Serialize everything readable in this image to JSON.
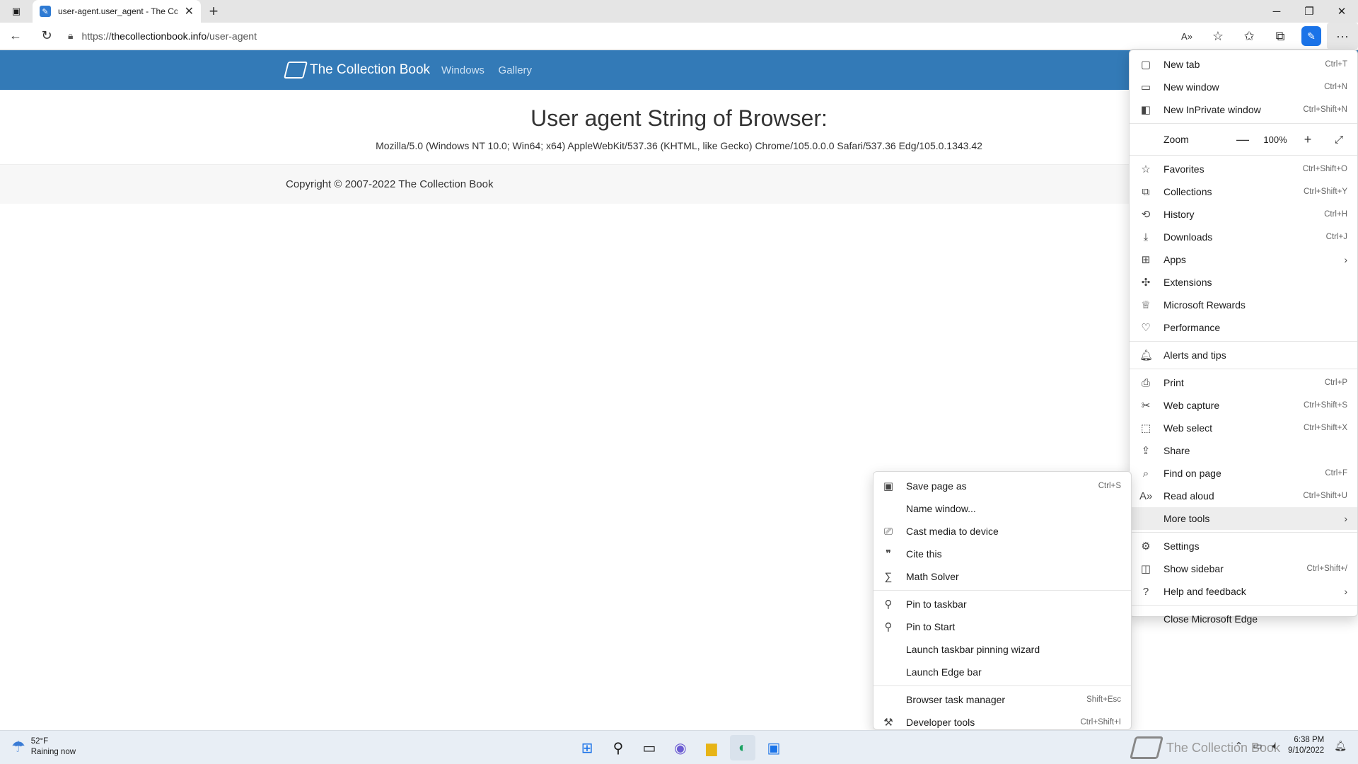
{
  "browser": {
    "tab_title": "user-agent.user_agent - The Col",
    "tab_favicon_icon": "site-favicon-icon",
    "url_scheme": "https://",
    "url_host": "thecollectionbook.info",
    "url_path": "/user-agent"
  },
  "site": {
    "brand": "The Collection Book",
    "nav": [
      "Windows",
      "Gallery"
    ],
    "heading": "User agent String of Browser:",
    "ua_string": "Mozilla/5.0 (Windows NT 10.0; Win64; x64) AppleWebKit/537.36 (KHTML, like Gecko) Chrome/105.0.0.0 Safari/537.36 Edg/105.0.1343.42",
    "copyright": "Copyright © 2007-2022 The Collection Book",
    "header_color": "#337ab7"
  },
  "menu": {
    "zoom_label": "Zoom",
    "zoom_value": "100%",
    "groups": [
      [
        {
          "label": "New tab",
          "shortcut": "Ctrl+T",
          "icon": "new-tab-icon"
        },
        {
          "label": "New window",
          "shortcut": "Ctrl+N",
          "icon": "new-window-icon"
        },
        {
          "label": "New InPrivate window",
          "shortcut": "Ctrl+Shift+N",
          "icon": "inprivate-icon"
        }
      ],
      [
        {
          "label": "Favorites",
          "shortcut": "Ctrl+Shift+O",
          "icon": "favorites-icon"
        },
        {
          "label": "Collections",
          "shortcut": "Ctrl+Shift+Y",
          "icon": "collections-icon"
        },
        {
          "label": "History",
          "shortcut": "Ctrl+H",
          "icon": "history-icon"
        },
        {
          "label": "Downloads",
          "shortcut": "Ctrl+J",
          "icon": "downloads-icon"
        },
        {
          "label": "Apps",
          "shortcut": "",
          "icon": "apps-icon",
          "submenu": true
        },
        {
          "label": "Extensions",
          "shortcut": "",
          "icon": "extensions-icon"
        },
        {
          "label": "Microsoft Rewards",
          "shortcut": "",
          "icon": "rewards-icon"
        },
        {
          "label": "Performance",
          "shortcut": "",
          "icon": "performance-icon"
        }
      ],
      [
        {
          "label": "Alerts and tips",
          "shortcut": "",
          "icon": "bell-icon"
        }
      ],
      [
        {
          "label": "Print",
          "shortcut": "Ctrl+P",
          "icon": "print-icon"
        },
        {
          "label": "Web capture",
          "shortcut": "Ctrl+Shift+S",
          "icon": "web-capture-icon"
        },
        {
          "label": "Web select",
          "shortcut": "Ctrl+Shift+X",
          "icon": "web-select-icon"
        },
        {
          "label": "Share",
          "shortcut": "",
          "icon": "share-icon"
        },
        {
          "label": "Find on page",
          "shortcut": "Ctrl+F",
          "icon": "find-icon"
        },
        {
          "label": "Read aloud",
          "shortcut": "Ctrl+Shift+U",
          "icon": "read-aloud-icon"
        },
        {
          "label": "More tools",
          "shortcut": "",
          "icon": "",
          "submenu": true,
          "highlighted": true
        }
      ],
      [
        {
          "label": "Settings",
          "shortcut": "",
          "icon": "gear-icon"
        },
        {
          "label": "Show sidebar",
          "shortcut": "Ctrl+Shift+/",
          "icon": "sidebar-icon"
        },
        {
          "label": "Help and feedback",
          "shortcut": "",
          "icon": "help-icon",
          "submenu": true
        }
      ],
      [
        {
          "label": "Close Microsoft Edge",
          "shortcut": "",
          "icon": ""
        }
      ]
    ]
  },
  "submenu": {
    "groups": [
      [
        {
          "label": "Save page as",
          "shortcut": "Ctrl+S",
          "icon": "save-icon"
        },
        {
          "label": "Name window...",
          "shortcut": "",
          "icon": ""
        },
        {
          "label": "Cast media to device",
          "shortcut": "",
          "icon": "cast-icon"
        },
        {
          "label": "Cite this",
          "shortcut": "",
          "icon": "quote-icon"
        },
        {
          "label": "Math Solver",
          "shortcut": "",
          "icon": "math-icon"
        }
      ],
      [
        {
          "label": "Pin to taskbar",
          "shortcut": "",
          "icon": "pin-icon"
        },
        {
          "label": "Pin to Start",
          "shortcut": "",
          "icon": "pin-icon"
        },
        {
          "label": "Launch taskbar pinning wizard",
          "shortcut": "",
          "icon": ""
        },
        {
          "label": "Launch Edge bar",
          "shortcut": "",
          "icon": ""
        }
      ],
      [
        {
          "label": "Browser task manager",
          "shortcut": "Shift+Esc",
          "icon": ""
        },
        {
          "label": "Developer tools",
          "shortcut": "Ctrl+Shift+I",
          "icon": "devtools-icon"
        }
      ]
    ]
  },
  "taskbar": {
    "temperature": "52°F",
    "weather": "Raining now",
    "time": "6:38 PM",
    "date": "9/10/2022",
    "watermark": "The Collection Book"
  }
}
